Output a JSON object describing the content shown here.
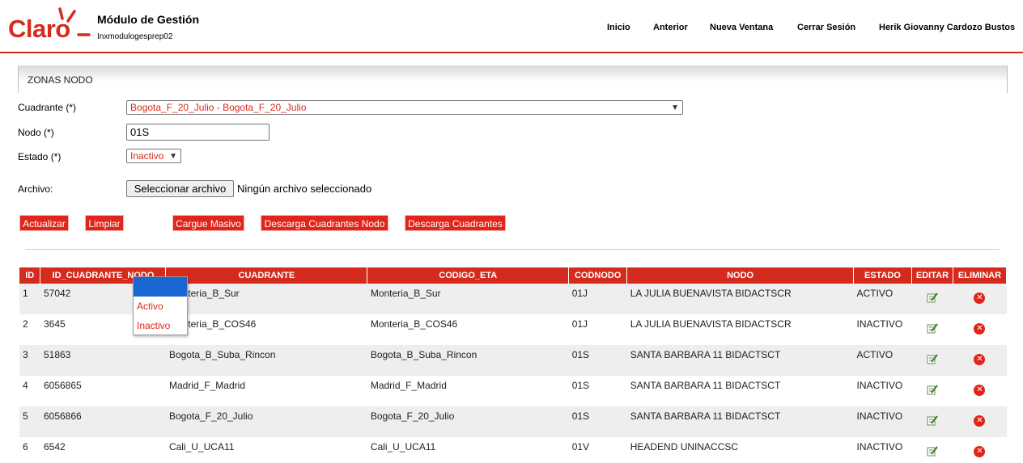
{
  "header": {
    "logo_text": "Claro",
    "app_title": "Módulo de Gestión",
    "app_subtitle": "Inxmodulogesprep02",
    "nav": [
      "Inicio",
      "Anterior",
      "Nueva Ventana",
      "Cerrar Sesión",
      "Herik Giovanny Cardozo Bustos"
    ]
  },
  "section": {
    "title": "ZONAS NODO"
  },
  "form": {
    "cuadrante_label": "Cuadrante (*)",
    "cuadrante_value": "Bogota_F_20_Julio - Bogota_F_20_Julio",
    "nodo_label": "Nodo (*)",
    "nodo_value": "01S",
    "estado_label": "Estado (*)",
    "estado_value": "Inactivo",
    "archivo_label": "Archivo:",
    "file_button": "Seleccionar archivo",
    "file_status": "Ningún archivo seleccionado"
  },
  "buttons": {
    "actualizar": "Actualizar",
    "limpiar": "Limpiar",
    "cargue": "Cargue Masivo",
    "descarga_nodo": "Descarga Cuadrantes Nodo",
    "descarga": "Descarga Cuadrantes"
  },
  "dropdown_options": [
    "",
    "Activo",
    "Inactivo"
  ],
  "table": {
    "headers": [
      "ID",
      "ID_CUADRANTE_NODO",
      "CUADRANTE",
      "CODIGO_ETA",
      "CODNODO",
      "NODO",
      "ESTADO",
      "EDITAR",
      "ELIMINAR"
    ],
    "rows": [
      [
        "1",
        "57042",
        "Monteria_B_Sur",
        "Monteria_B_Sur",
        "01J",
        "LA JULIA BUENAVISTA BIDACTSCR",
        "ACTIVO"
      ],
      [
        "2",
        "3645",
        "Monteria_B_COS46",
        "Monteria_B_COS46",
        "01J",
        "LA JULIA BUENAVISTA BIDACTSCR",
        "INACTIVO"
      ],
      [
        "3",
        "51863",
        "Bogota_B_Suba_Rincon",
        "Bogota_B_Suba_Rincon",
        "01S",
        "SANTA BARBARA 11 BIDACTSCT",
        "ACTIVO"
      ],
      [
        "4",
        "6056865",
        "Madrid_F_Madrid",
        "Madrid_F_Madrid",
        "01S",
        "SANTA BARBARA 11 BIDACTSCT",
        "INACTIVO"
      ],
      [
        "5",
        "6056866",
        "Bogota_F_20_Julio",
        "Bogota_F_20_Julio",
        "01S",
        "SANTA BARBARA 11 BIDACTSCT",
        "INACTIVO"
      ],
      [
        "6",
        "6542",
        "Cali_U_UCA11",
        "Cali_U_UCA11",
        "01V",
        "HEADEND UNINACCSC",
        "INACTIVO"
      ]
    ]
  },
  "colors": {
    "brand": "#d52b1e",
    "row_alt": "#eeeeee",
    "selected_option": "#1a66d2"
  }
}
